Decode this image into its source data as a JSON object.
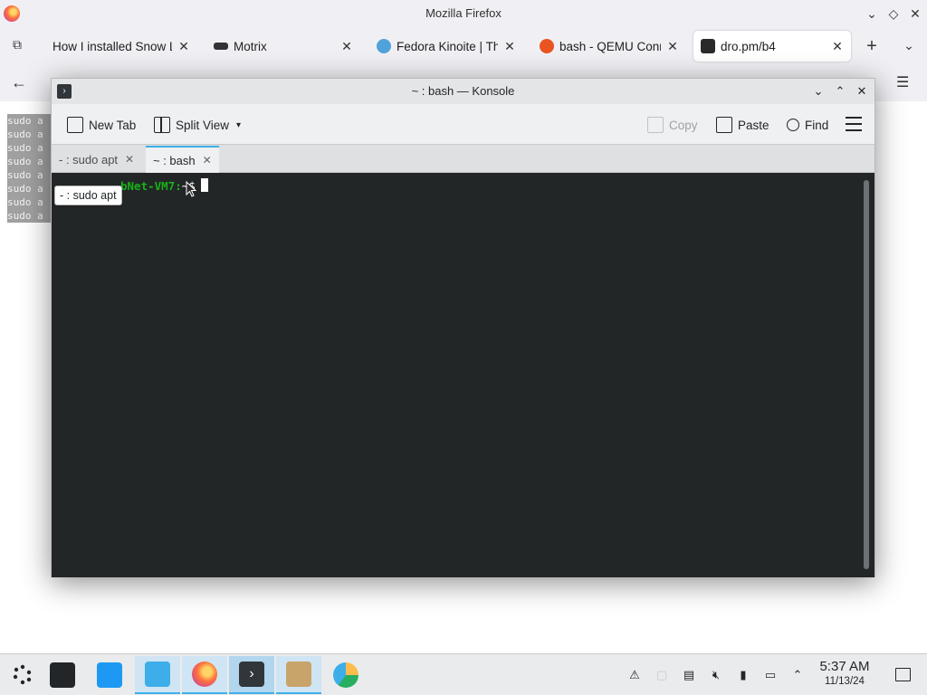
{
  "firefox": {
    "title": "Mozilla Firefox",
    "tabs": [
      {
        "label": "How I installed Snow L",
        "icon": "doc-icon"
      },
      {
        "label": "Motrix",
        "icon": "motrix-icon"
      },
      {
        "label": "Fedora Kinoite | Th",
        "icon": "fedora-icon"
      },
      {
        "label": "bash - QEMU Conn",
        "icon": "askubuntu-icon"
      },
      {
        "label": "dro.pm/b4",
        "icon": "drop-icon",
        "active": true
      }
    ],
    "page_text_lines": [
      "sudo a",
      "sudo a",
      "sudo a",
      "sudo a",
      "sudo a",
      "sudo a",
      "sudo a",
      "sudo a"
    ]
  },
  "konsole": {
    "title": "~ : bash — Konsole",
    "toolbar": {
      "new_tab": "New Tab",
      "split_view": "Split View",
      "copy": "Copy",
      "paste": "Paste",
      "find": "Find"
    },
    "tabs": [
      {
        "label": "- : sudo apt",
        "active": false
      },
      {
        "label": "~ : bash",
        "active": true
      }
    ],
    "tooltip": "- : sudo apt",
    "prompt_host": "bNet-VM7:",
    "prompt_symbol": "~$"
  },
  "taskbar": {
    "clock_time": "5:37 AM",
    "clock_date": "11/13/24"
  },
  "colors": {
    "accent": "#3daee9",
    "terminal_bg": "#232627",
    "prompt_green": "#18b218"
  }
}
